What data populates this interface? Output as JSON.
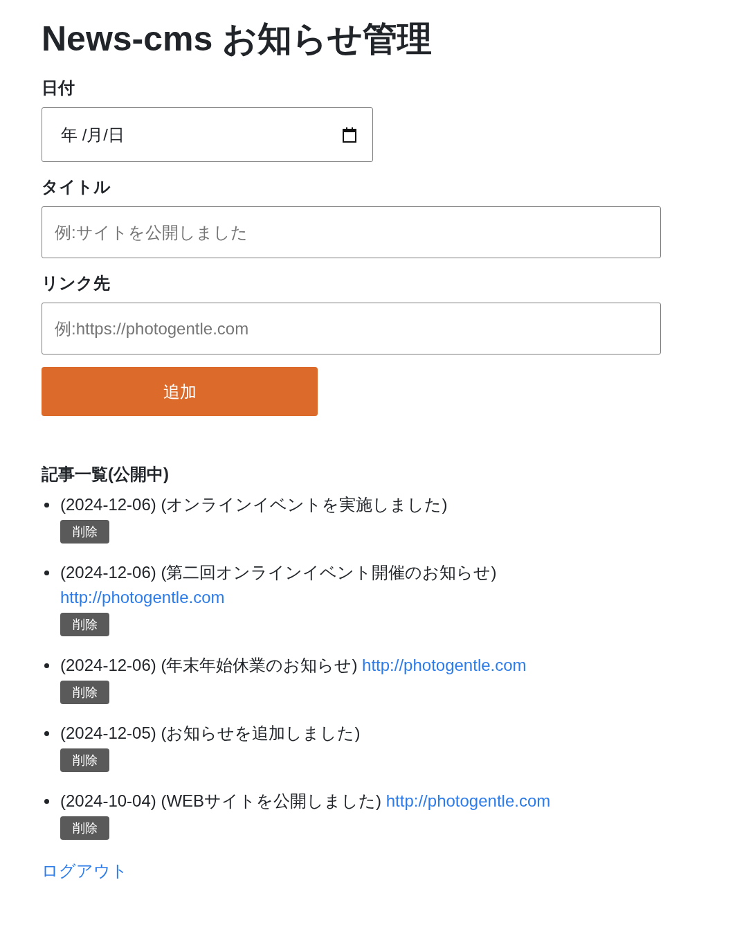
{
  "page": {
    "title": "News-cms お知らせ管理"
  },
  "form": {
    "fields": [
      {
        "kind": "date",
        "label": "日付",
        "placeholder": "年 /月/日"
      },
      {
        "kind": "text",
        "label": "タイトル",
        "placeholder": "例:サイトを公開しました"
      },
      {
        "kind": "text",
        "label": "リンク先",
        "placeholder": "例:https://photogentle.com"
      }
    ],
    "submit": "追加"
  },
  "articles": {
    "heading": "記事一覧(公開中)",
    "items": [
      {
        "text": "(2024-12-06) (オンラインイベントを実施しました)",
        "delete": "削除"
      },
      {
        "text": "(2024-12-06) (第二回オンラインイベント開催のお知らせ)",
        "link": "http://photogentle.com",
        "delete": "削除"
      },
      {
        "text": "(2024-12-06) (年末年始休業のお知らせ)",
        "link": "http://photogentle.com",
        "delete": "削除"
      },
      {
        "text": "(2024-12-05) (お知らせを追加しました)",
        "delete": "削除"
      },
      {
        "text": "(2024-10-04) (WEBサイトを公開しました)",
        "link": "http://photogentle.com",
        "delete": "削除"
      }
    ]
  },
  "logout": "ログアウト"
}
